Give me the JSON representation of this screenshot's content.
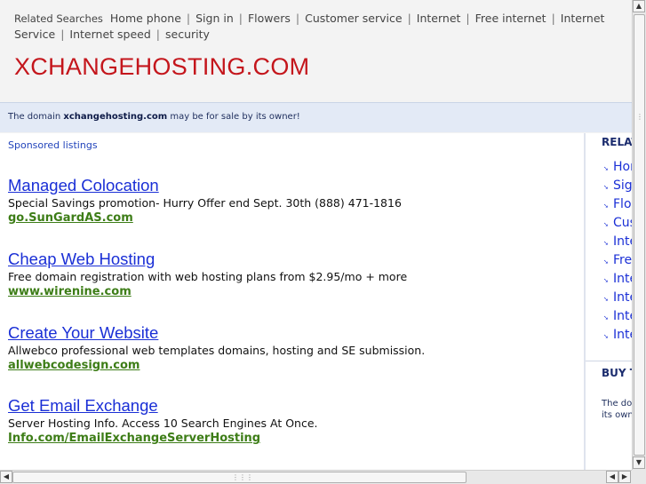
{
  "top_bar": {
    "label": "Related Searches",
    "links": [
      "Home phone",
      "Sign in",
      "Flowers",
      "Customer service",
      "Internet",
      "Free internet",
      "Internet Service",
      "Internet speed",
      "security"
    ]
  },
  "site_title": "XCHANGEHOSTING.COM",
  "sale_notice": {
    "prefix": "The domain",
    "domain": "xchangehosting.com",
    "suffix": "may be for sale by its owner!"
  },
  "sponsored_label": "Sponsored listings",
  "ads": [
    {
      "title": "Managed Colocation",
      "desc": "Special Savings promotion- Hurry Offer end Sept. 30th (888) 471-1816",
      "url": "go.SunGardAS.com"
    },
    {
      "title": "Cheap Web Hosting",
      "desc": "Free domain registration with web hosting plans from $2.95/mo + more",
      "url": "www.wirenine.com"
    },
    {
      "title": "Create Your Website",
      "desc": "Allwebco professional web templates domains, hosting and SE submission.",
      "url": "allwebcodesign.com"
    },
    {
      "title": "Get Email Exchange",
      "desc": "Server Hosting Info. Access 10 Search Engines At Once.",
      "url": "Info.com/EmailExchangeServerHosting"
    }
  ],
  "sidebar": {
    "related_heading": "RELAT",
    "items": [
      "Hor",
      "Sig",
      "Flo",
      "Cus",
      "Inte",
      "Fre",
      "Inte",
      "Inte",
      "Inte",
      "Inte"
    ],
    "buy_heading": "BUY T",
    "buy_text_line1": "The don",
    "buy_text_line2": "its owne"
  },
  "icons": {
    "bullet": "arrow-bullet-icon",
    "scroll_up": "chevron-up-icon",
    "scroll_down": "chevron-down-icon",
    "scroll_left": "chevron-left-icon",
    "scroll_right": "chevron-right-icon"
  },
  "colors": {
    "title_red": "#c4161c",
    "link_blue": "#1a2fd6",
    "url_green": "#3d7d17",
    "notice_bg": "#e3eaf6"
  }
}
